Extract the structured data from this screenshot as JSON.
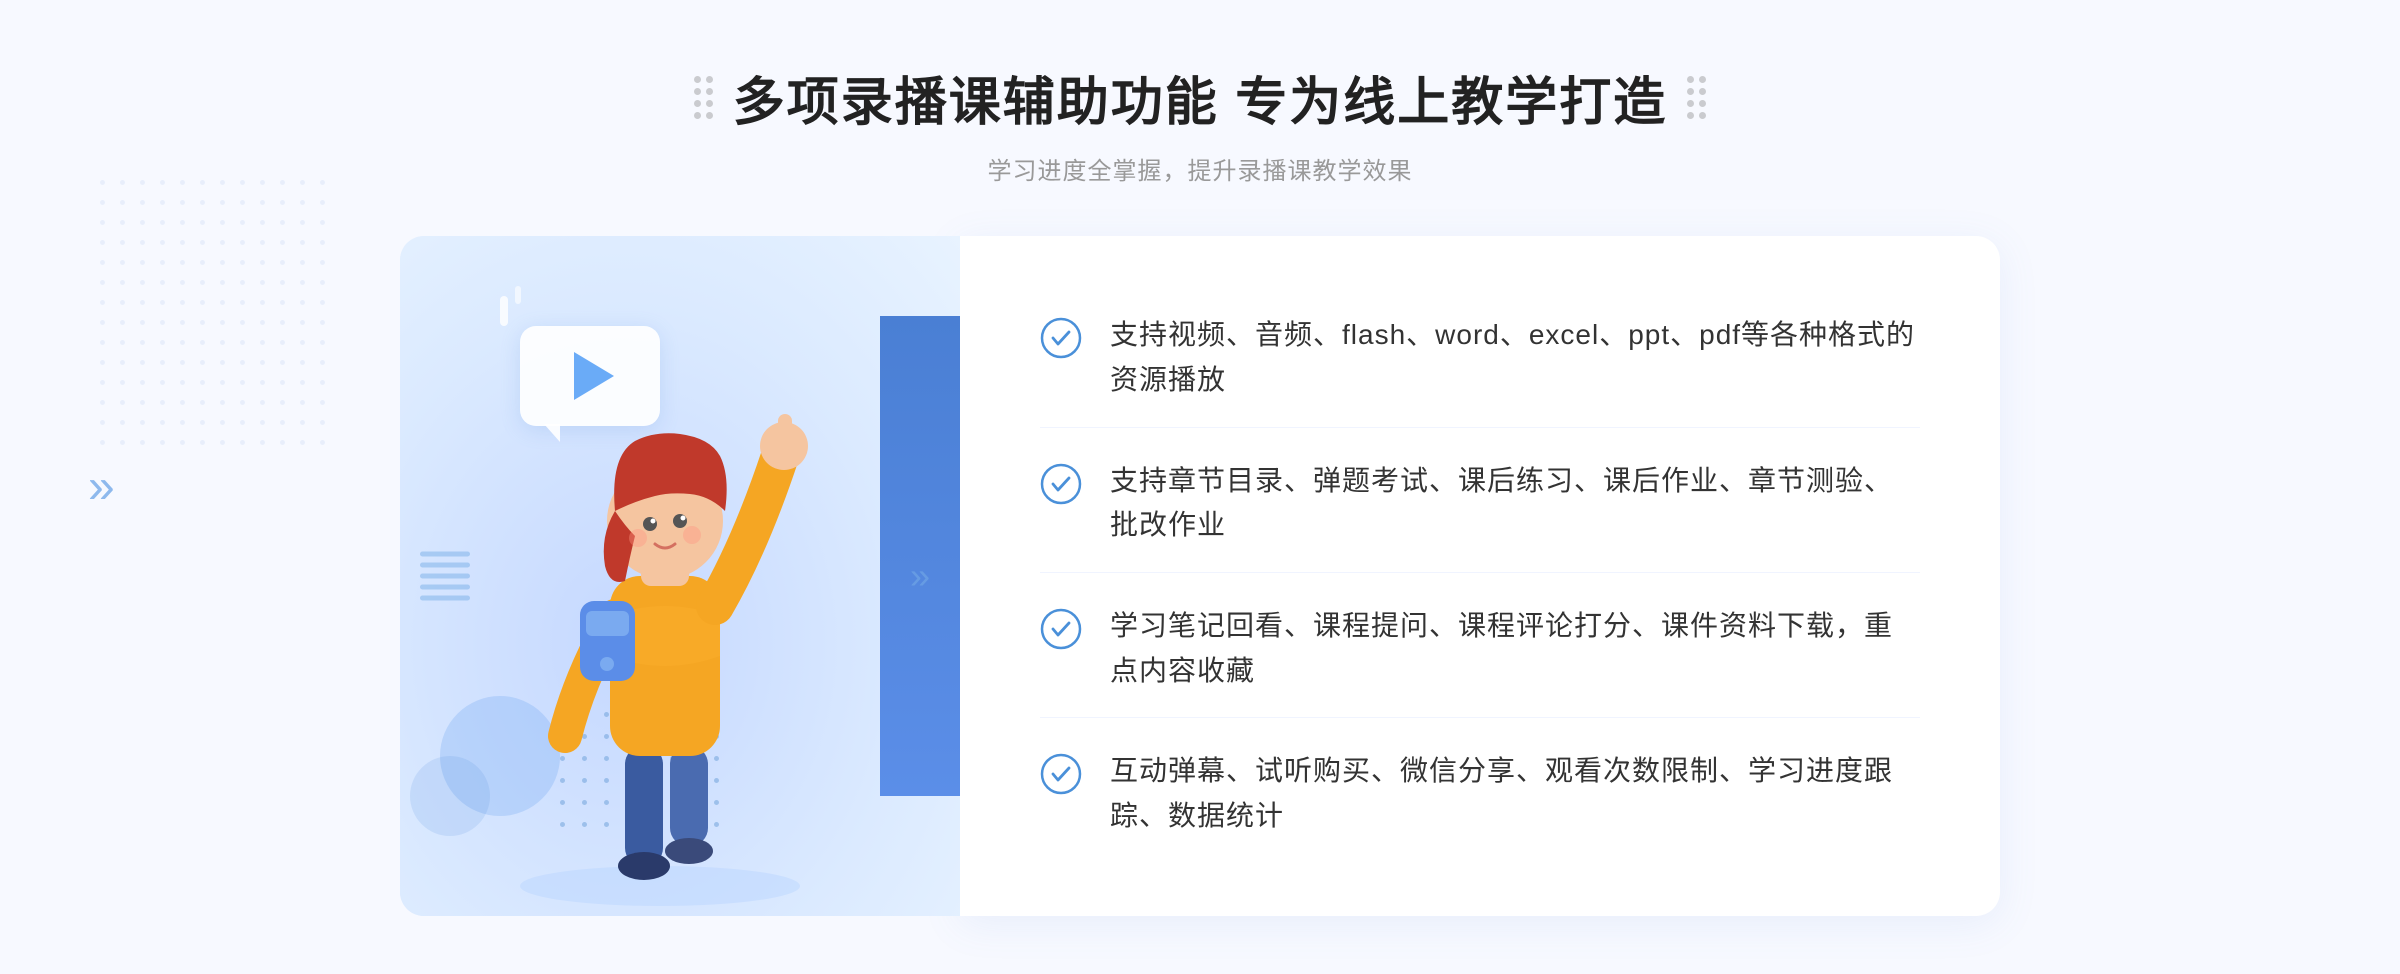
{
  "header": {
    "title": "多项录播课辅助功能 专为线上教学打造",
    "subtitle": "学习进度全掌握，提升录播课教学效果"
  },
  "features": [
    {
      "id": 1,
      "text": "支持视频、音频、flash、word、excel、ppt、pdf等各种格式的资源播放"
    },
    {
      "id": 2,
      "text": "支持章节目录、弹题考试、课后练习、课后作业、章节测验、批改作业"
    },
    {
      "id": 3,
      "text": "学习笔记回看、课程提问、课程评论打分、课件资料下载，重点内容收藏"
    },
    {
      "id": 4,
      "text": "互动弹幕、试听购买、微信分享、观看次数限制、学习进度跟踪、数据统计"
    }
  ],
  "icons": {
    "chevron_left": "《",
    "play": "▶",
    "check_color": "#4a90d9"
  }
}
